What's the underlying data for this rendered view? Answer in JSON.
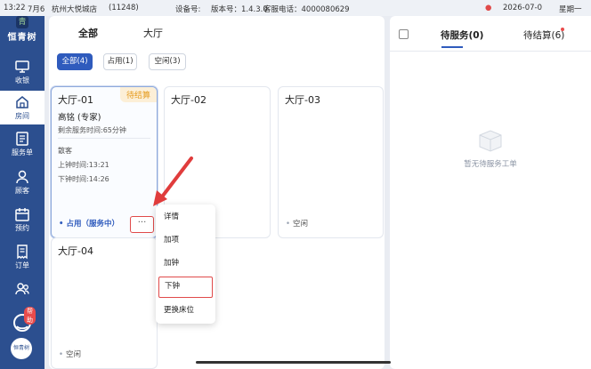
{
  "statusbar": {
    "time": "13:22",
    "date_short": "7月6",
    "store": "杭州大悦城店",
    "store_id": "(11248)",
    "device_label": "设备号:",
    "version": "版本号：1.4.3.0",
    "hotline": "客服电话：4000080629",
    "datetime": "2026-07-0",
    "status_tail": "星期一"
  },
  "sidebar": {
    "brand": "恒青树",
    "brand_mark": "青",
    "items": [
      {
        "label": "收银",
        "icon": "monitor-icon"
      },
      {
        "label": "房间",
        "icon": "home-icon"
      },
      {
        "label": "服务单",
        "icon": "service-order-icon"
      },
      {
        "label": "顾客",
        "icon": "customer-icon"
      },
      {
        "label": "预约",
        "icon": "calendar-icon"
      },
      {
        "label": "订单",
        "icon": "order-icon"
      },
      {
        "label": "",
        "icon": "staff-icon"
      }
    ],
    "help_badge": "帮助",
    "avatar_text": "恒青树"
  },
  "main": {
    "tabs": [
      {
        "label": "全部"
      },
      {
        "label": "大厅"
      }
    ],
    "filters": [
      {
        "label": "全部(4)"
      },
      {
        "label": "占用(1)"
      },
      {
        "label": "空闲(3)"
      }
    ],
    "rooms": [
      {
        "name": "大厅-01",
        "tag": "待结算",
        "technician": "高铭 (专家)",
        "remaining": "剩余服务时间:65分钟",
        "customer": "散客",
        "start": "上钟时间:13:21",
        "end": "下钟时间:14:26",
        "status": "占用（服务中）",
        "more": "···"
      },
      {
        "name": "大厅-02",
        "status": ""
      },
      {
        "name": "大厅-03",
        "status": "空闲"
      },
      {
        "name": "大厅-04",
        "status": "空闲"
      }
    ]
  },
  "menu": {
    "items": [
      {
        "label": "详情"
      },
      {
        "label": "加项"
      },
      {
        "label": "加钟"
      },
      {
        "label": "下钟"
      },
      {
        "label": "更换床位"
      }
    ]
  },
  "right": {
    "tabs": [
      {
        "label": "待服务(0)"
      },
      {
        "label": "待结算(6)"
      }
    ],
    "empty_text": "暂无待服务工单"
  },
  "colors": {
    "sidebar": "#2c4f8f",
    "accent": "#2f5bbd",
    "highlight": "#e04a4a",
    "pending": "#e59b1f"
  }
}
